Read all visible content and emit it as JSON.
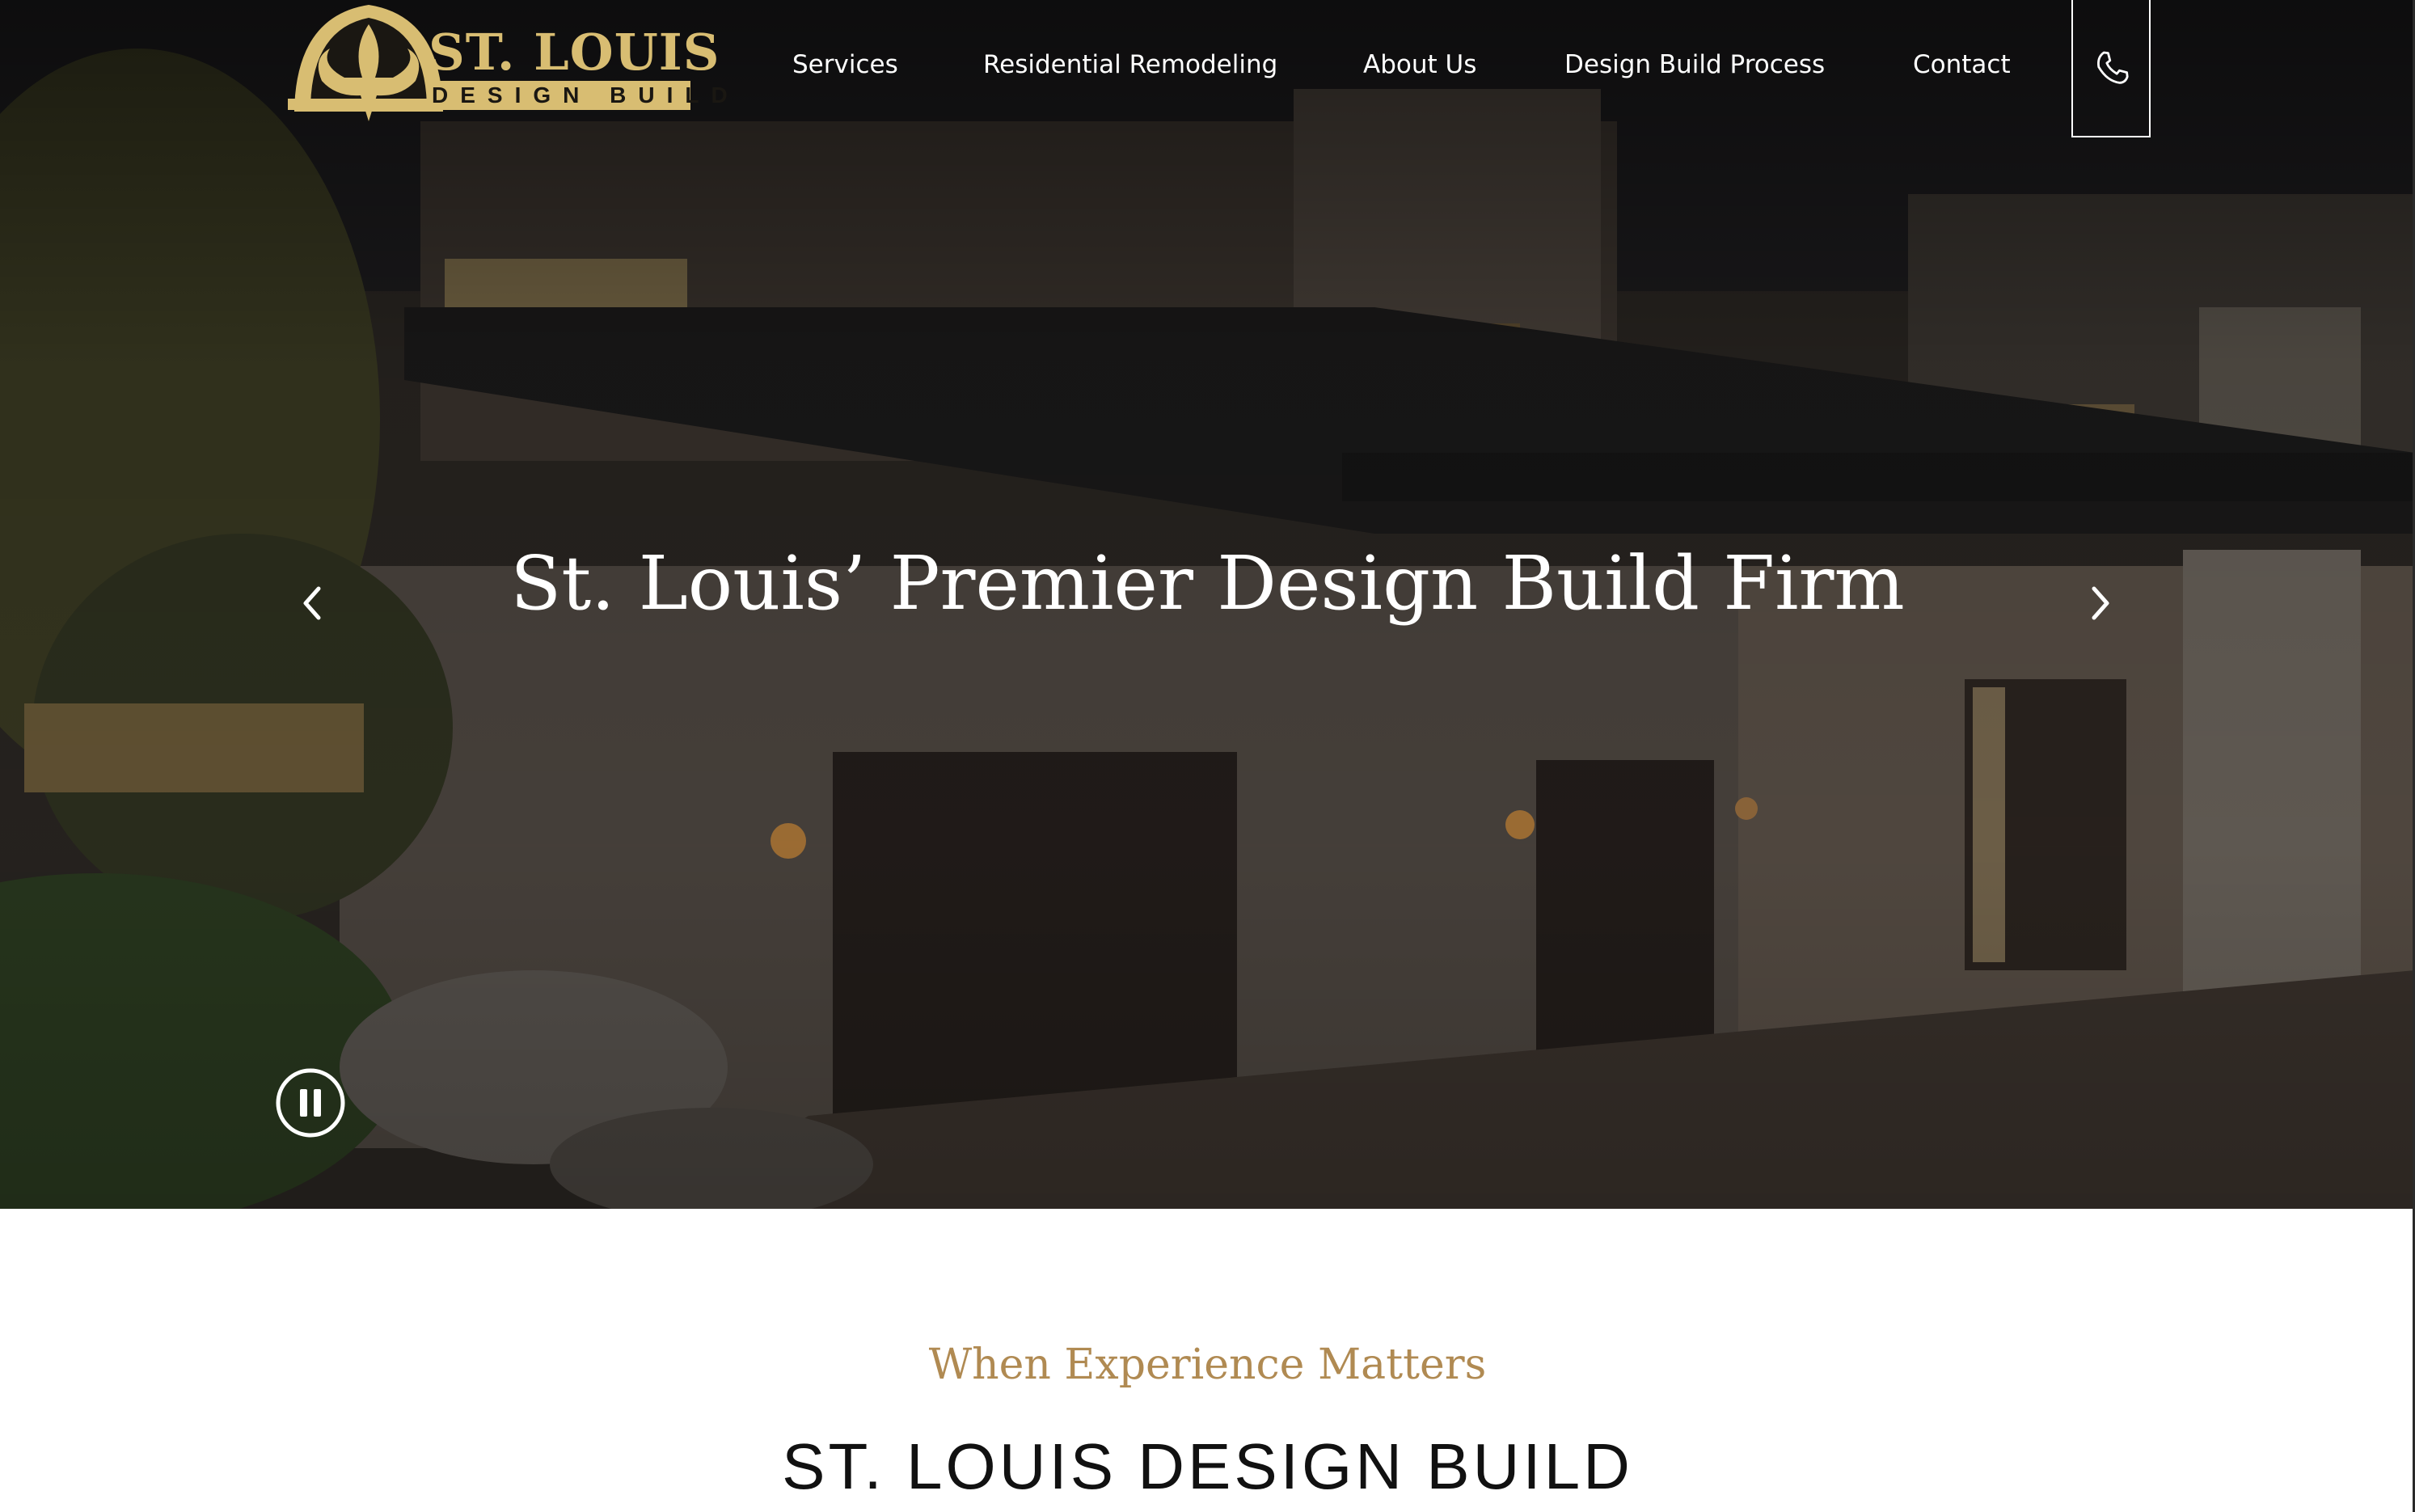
{
  "brand": {
    "logo_title": "ST. LOUIS",
    "logo_subtitle": "DESIGN BUILD",
    "gold_color": "#d8bd72"
  },
  "nav": {
    "items": [
      {
        "label": "Services"
      },
      {
        "label": "Residential Remodeling"
      },
      {
        "label": "About Us"
      },
      {
        "label": "Design Build Process"
      },
      {
        "label": "Contact"
      }
    ],
    "phone_icon": "phone-icon"
  },
  "hero": {
    "title": "St. Louis’ Premier Design Build Firm",
    "prev_icon": "chevron-left-icon",
    "next_icon": "chevron-right-icon",
    "pause_icon": "pause-icon"
  },
  "intro": {
    "eyebrow": "When Experience Matters",
    "heading": "ST. LOUIS DESIGN BUILD",
    "eyebrow_color": "#b08a52"
  }
}
